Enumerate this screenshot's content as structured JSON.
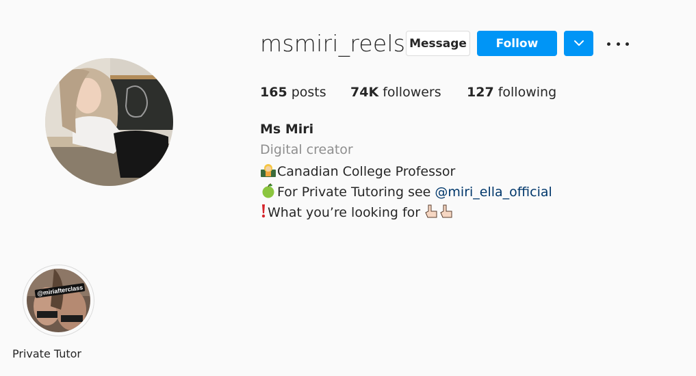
{
  "profile": {
    "username": "msmiri_reels",
    "buttons": {
      "message": "Message",
      "follow": "Follow",
      "options_icon": "chevron-down-icon",
      "more_icon": "more-horizontal-icon"
    },
    "stats": {
      "posts_count": "165",
      "posts_label": " posts",
      "followers_count": "74K",
      "followers_label": " followers",
      "following_count": "127",
      "following_label": " following"
    },
    "bio": {
      "name": "Ms Miri",
      "category": "Digital creator",
      "line1": {
        "emoji": "woman-teacher-emoji",
        "text": "Canadian College Professor"
      },
      "line2": {
        "emoji": "green-apple-emoji",
        "text": "For Private Tutoring see ",
        "mention": "@miri_ella_official"
      },
      "line3": {
        "emoji": "exclamation-emoji",
        "text": "What you’re looking for ",
        "trailing_emoji": "pointing-up-hands-emoji"
      }
    }
  },
  "highlights": [
    {
      "label": "Private Tutor",
      "tag": "@miriafterclass"
    }
  ],
  "colors": {
    "accent": "#0095f6",
    "text": "#262626",
    "secondary_text": "#8e8e8e",
    "link": "#00376b",
    "background": "#fafafa"
  }
}
